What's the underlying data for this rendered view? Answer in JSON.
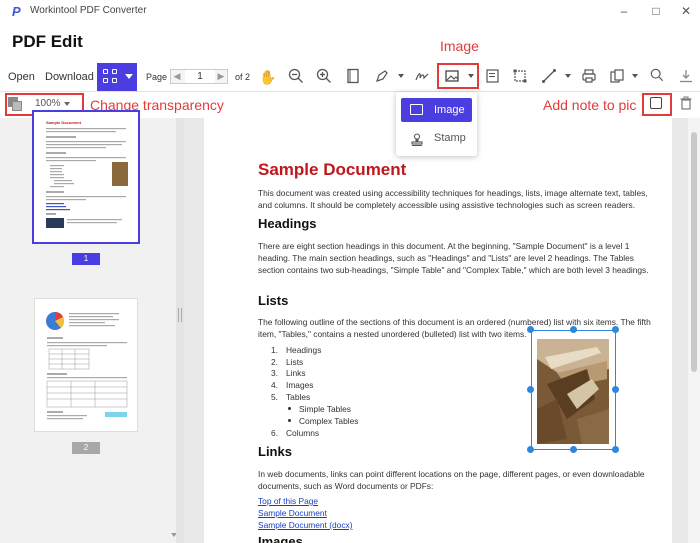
{
  "app": {
    "title": "Workintool PDF Converter",
    "page_title": "PDF Edit"
  },
  "toolbar": {
    "open_label": "Open",
    "download_label": "Download",
    "page_label": "Page",
    "page_value": "1",
    "page_total": "of 2"
  },
  "subbar": {
    "zoom": "100%"
  },
  "dropdown": {
    "items": [
      {
        "label": "Image"
      },
      {
        "label": "Stamp"
      }
    ]
  },
  "annotations": {
    "image": "Image",
    "transparency": "Change transparency",
    "note": "Add note to pic"
  },
  "thumbnails": {
    "page1": "1",
    "page2": "2"
  },
  "document": {
    "title": "Sample Document",
    "intro": "This document was created using accessibility techniques for headings, lists, image alternate text, tables, and columns. It should be completely accessible using assistive technologies such as screen readers.",
    "h_headings": "Headings",
    "p_headings": "There are eight section headings in this document. At the beginning, \"Sample Document\" is a level 1 heading. The main section headings, such as \"Headings\" and \"Lists\" are level 2 headings. The Tables section contains two sub-headings, \"Simple Table\" and \"Complex Table,\" which are both level 3 headings.",
    "h_lists": "Lists",
    "p_lists": "The following outline of the sections of this document is an ordered (numbered) list with six items. The fifth item, \"Tables,\" contains a nested unordered (bulleted) list with two items.",
    "list": [
      "1.",
      "Headings",
      "2.",
      "Lists",
      "3.",
      "Links",
      "4.",
      "Images",
      "5.",
      "Tables",
      "6.",
      "Columns"
    ],
    "sublist": [
      "Simple Tables",
      "Complex Tables"
    ],
    "h_links": "Links",
    "p_links": "In web documents, links can point different locations on the page, different pages, or even downloadable documents, such as Word documents or PDFs:",
    "links": [
      "Top of this Page",
      "Sample Document",
      "Sample Document (docx)"
    ],
    "h_images": "Images"
  },
  "colors": {
    "accent": "#4b3ee0",
    "annotation": "#e23b3b",
    "doc_title": "#c0171c",
    "selection": "#2e86de"
  }
}
